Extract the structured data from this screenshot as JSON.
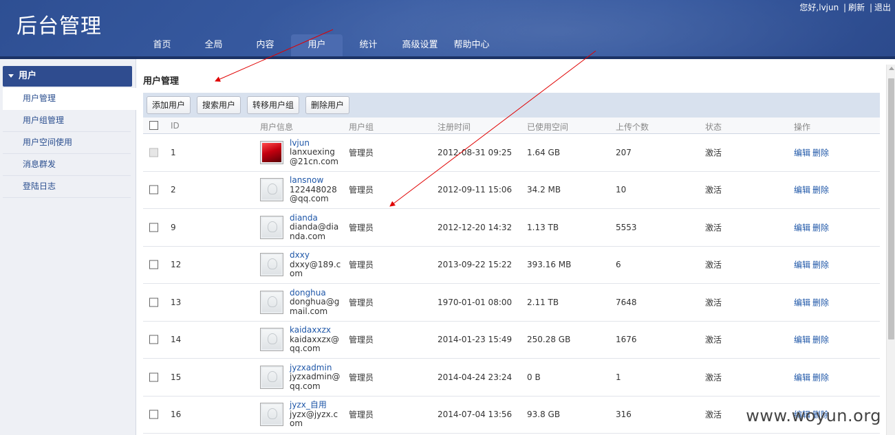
{
  "header": {
    "logo": "后台管理",
    "greeting": "您好,lvjun",
    "links": [
      "刷新",
      "退出"
    ],
    "nav": [
      "首页",
      "全局",
      "内容",
      "用户",
      "统计",
      "高级设置",
      "帮助中心"
    ],
    "active_nav": 3
  },
  "sidebar": {
    "section": "用户",
    "items": [
      "用户管理",
      "用户组管理",
      "用户空间使用",
      "消息群发",
      "登陆日志"
    ],
    "active_item": 0
  },
  "main": {
    "title": "用户管理",
    "toolbar": [
      "添加用户",
      "搜索用户",
      "转移用户组",
      "删除用户"
    ],
    "columns": [
      "ID",
      "用户信息",
      "用户组",
      "注册时间",
      "已使用空间",
      "上传个数",
      "状态",
      "操作"
    ],
    "edit_label": "编辑",
    "delete_label": "删除",
    "rows": [
      {
        "id": "1",
        "name": "lvjun",
        "email": "lanxuexing@21cn.com",
        "group": "管理员",
        "registered": "2012-08-31 09:25",
        "used": "1.64 GB",
        "uploads": "207",
        "status": "激活",
        "avatar": "red",
        "checkbox_disabled": true
      },
      {
        "id": "2",
        "name": "lansnow",
        "email": "122448028@qq.com",
        "group": "管理员",
        "registered": "2012-09-11 15:06",
        "used": "34.2 MB",
        "uploads": "10",
        "status": "激活",
        "avatar": "default",
        "checkbox_disabled": false
      },
      {
        "id": "9",
        "name": "dianda",
        "email": "dianda@dianda.com",
        "group": "管理员",
        "registered": "2012-12-20 14:32",
        "used": "1.13 TB",
        "uploads": "5553",
        "status": "激活",
        "avatar": "default",
        "checkbox_disabled": false
      },
      {
        "id": "12",
        "name": "dxxy",
        "email": "dxxy@189.com",
        "group": "管理员",
        "registered": "2013-09-22 15:22",
        "used": "393.16 MB",
        "uploads": "6",
        "status": "激活",
        "avatar": "default",
        "checkbox_disabled": false
      },
      {
        "id": "13",
        "name": "donghua",
        "email": "donghua@gmail.com",
        "group": "管理员",
        "registered": "1970-01-01 08:00",
        "used": "2.11 TB",
        "uploads": "7648",
        "status": "激活",
        "avatar": "default",
        "checkbox_disabled": false
      },
      {
        "id": "14",
        "name": "kaidaxxzx",
        "email": "kaidaxxzx@qq.com",
        "group": "管理员",
        "registered": "2014-01-23 15:49",
        "used": "250.28 GB",
        "uploads": "1676",
        "status": "激活",
        "avatar": "default",
        "checkbox_disabled": false
      },
      {
        "id": "15",
        "name": "jyzxadmin",
        "email": "jyzxadmin@qq.com",
        "group": "管理员",
        "registered": "2014-04-24 23:24",
        "used": "0 B",
        "uploads": "1",
        "status": "激活",
        "avatar": "default",
        "checkbox_disabled": false
      },
      {
        "id": "16",
        "name": "jyzx_自用",
        "email": "jyzx@jyzx.com",
        "group": "管理员",
        "registered": "2014-07-04 13:56",
        "used": "93.8 GB",
        "uploads": "316",
        "status": "激活",
        "avatar": "default",
        "checkbox_disabled": false
      }
    ]
  },
  "watermark": "www.woyun.org",
  "colors": {
    "header_bg": "#3a5da4",
    "sidebar_head": "#2f4c8f",
    "link": "#1f57a8",
    "annotation_arrow": "#e00000"
  }
}
